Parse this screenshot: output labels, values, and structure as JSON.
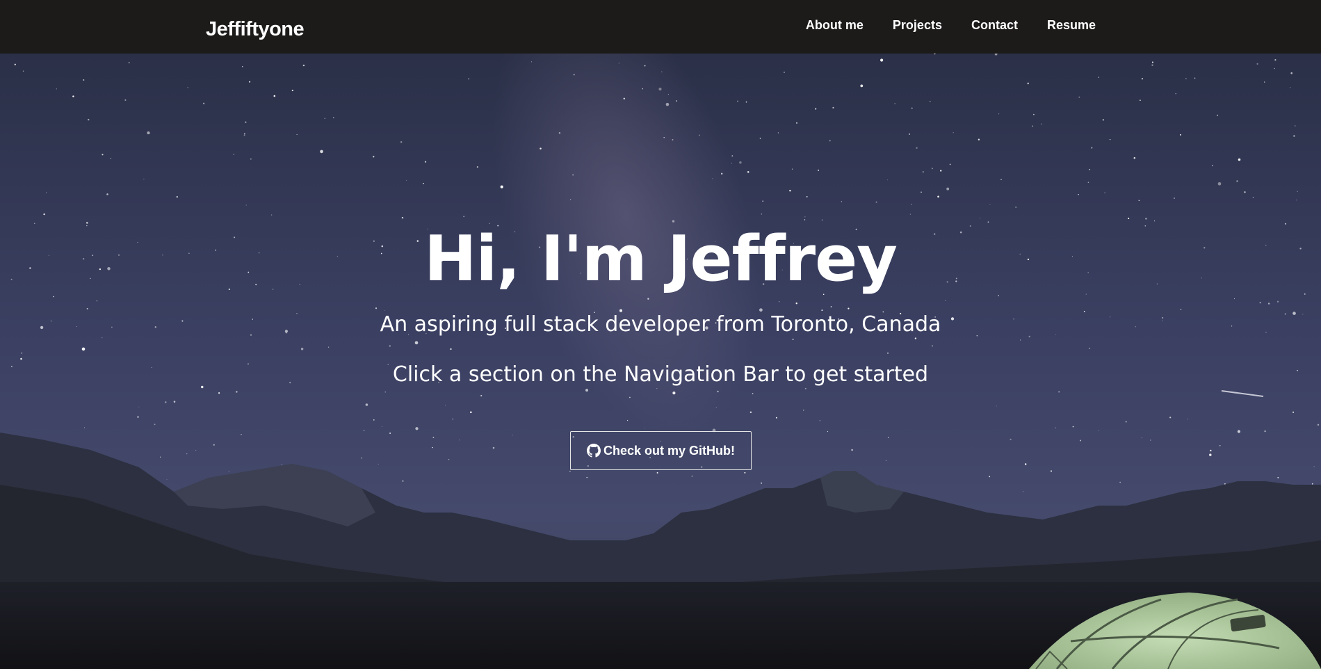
{
  "navbar": {
    "brand": "Jeffiftyone",
    "links": [
      {
        "label": "About me"
      },
      {
        "label": "Projects"
      },
      {
        "label": "Contact"
      },
      {
        "label": "Resume"
      }
    ]
  },
  "hero": {
    "title": "Hi, I'm Jeffrey",
    "subtitle": "An aspiring full stack developer from Toronto, Canada",
    "instruction": "Click a section on the Navigation Bar to get started",
    "button": {
      "label": "Check out my GitHub!",
      "icon": "github-icon"
    }
  },
  "colors": {
    "navbar_bg": "#1c1b1a",
    "sky_top": "#2b3048",
    "sky_mid": "#464b6e",
    "mountains": "#2a2d3a",
    "foreground": "#131316",
    "tent": "#a8c29a",
    "text": "#ffffff"
  }
}
